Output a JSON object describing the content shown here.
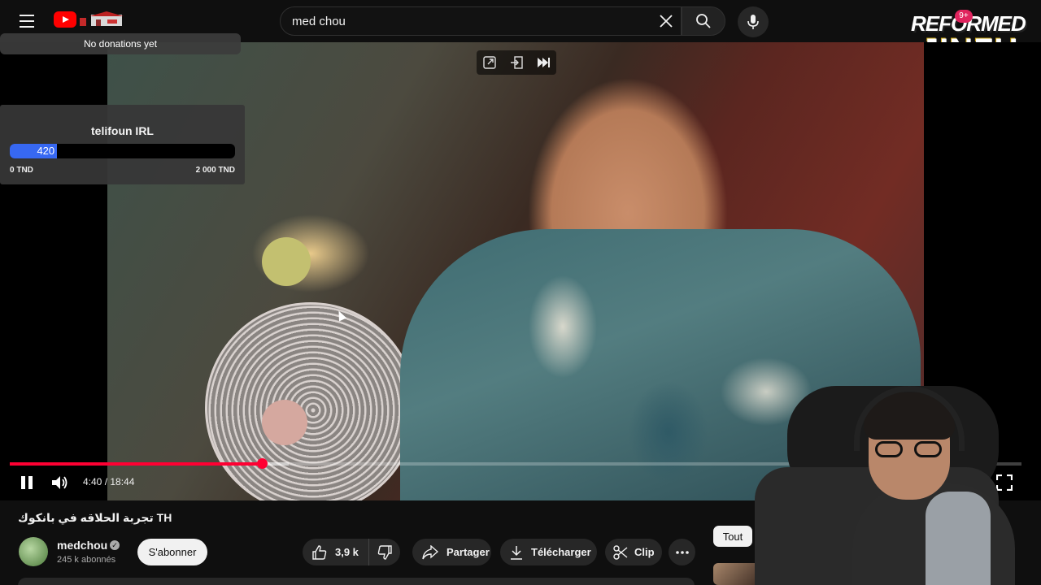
{
  "search": {
    "query": "med chou"
  },
  "brand": {
    "line1": "REFORMED",
    "line2": "JINZU",
    "badge": "9+"
  },
  "donations": {
    "text": "No donations yet"
  },
  "goal": {
    "title": "telifoun IRL",
    "current": "420",
    "min_label": "0 TND",
    "max_label": "2 000 TND",
    "progress_fraction": 0.21,
    "fill_color": "#3768f2"
  },
  "player": {
    "time": "4:40 / 18:44",
    "played_fraction": 0.249,
    "buffered_fraction": 0.276,
    "accent": "#ff0033"
  },
  "video": {
    "title": "تجربة الحلاقه في بانكوك TH",
    "channel": "medchou",
    "subscribers": "245 k abonnés",
    "subscribe_label": "S'abonner",
    "likes": "3,9 k",
    "share_label": "Partager",
    "download_label": "Télécharger",
    "clip_label": "Clip"
  },
  "sidebar": {
    "chip_all": "Tout"
  }
}
